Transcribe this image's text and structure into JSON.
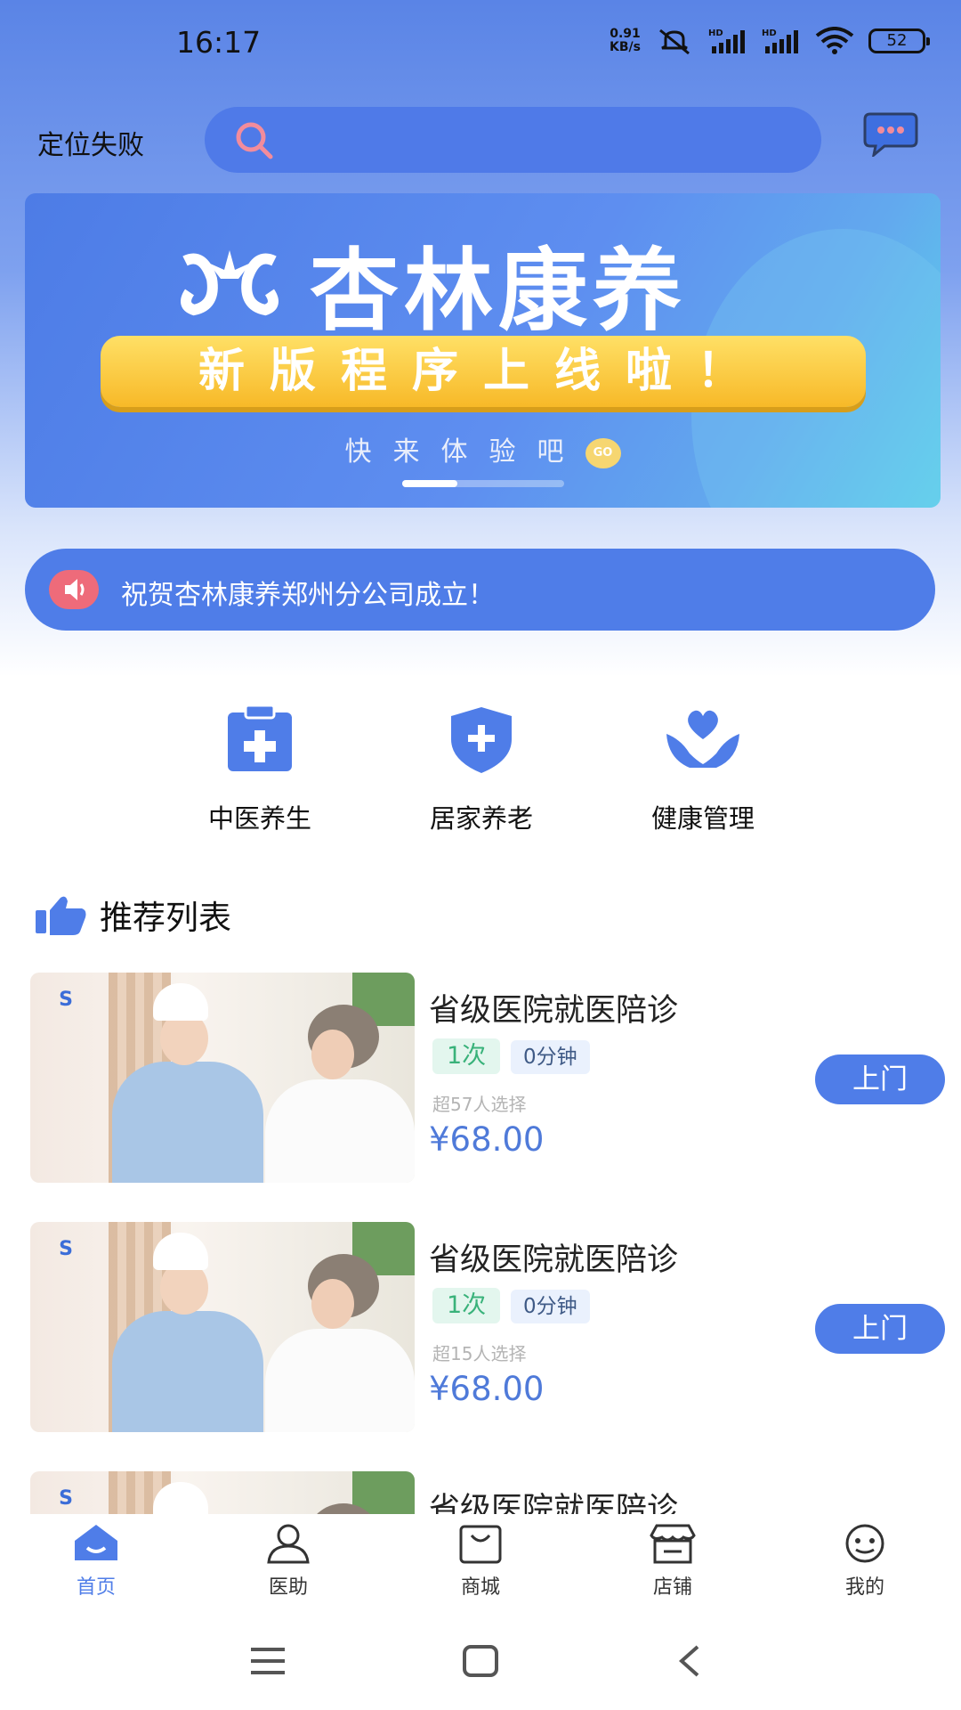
{
  "status_bar": {
    "time": "16:17",
    "net_speed_value": "0.91",
    "net_speed_unit": "KB/s",
    "battery": "52"
  },
  "header": {
    "location": "定位失败",
    "search_placeholder": ""
  },
  "banner": {
    "brand": "杏林康养",
    "headline": "新版程序上线啦！",
    "sub": "快来体验吧",
    "go": "GO"
  },
  "notice": {
    "text": "祝贺杏林康养郑州分公司成立！"
  },
  "categories": [
    {
      "label": "中医养生",
      "icon": "clipboard-plus-icon"
    },
    {
      "label": "居家养老",
      "icon": "shield-plus-icon"
    },
    {
      "label": "健康管理",
      "icon": "heart-hands-icon"
    }
  ],
  "recommend": {
    "title": "推荐列表",
    "items": [
      {
        "title": "省级医院就医陪诊",
        "times": "1次",
        "duration": "0分钟",
        "sold": "超57人选择",
        "price": "¥68.00",
        "action": "上门"
      },
      {
        "title": "省级医院就医陪诊",
        "times": "1次",
        "duration": "0分钟",
        "sold": "超15人选择",
        "price": "¥68.00",
        "action": "上门"
      },
      {
        "title": "省级医院就医陪诊"
      }
    ]
  },
  "tabs": [
    {
      "label": "首页",
      "icon": "home-icon",
      "active": true
    },
    {
      "label": "医助",
      "icon": "assistant-icon"
    },
    {
      "label": "商城",
      "icon": "shopping-bag-icon"
    },
    {
      "label": "店铺",
      "icon": "store-icon"
    },
    {
      "label": "我的",
      "icon": "profile-face-icon"
    }
  ],
  "colors": {
    "primary": "#4f7de8",
    "accent_yellow": "#f7b928",
    "tag_green": "#39b27a"
  }
}
